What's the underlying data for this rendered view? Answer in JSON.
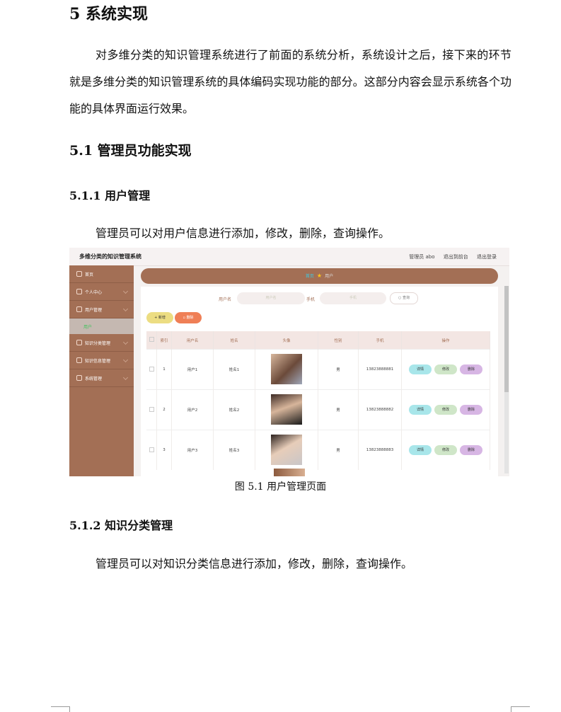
{
  "doc": {
    "h_chapter": "5  系统实现",
    "intro": "对多维分类的知识管理系统进行了前面的系统分析，系统设计之后，接下来的环节就是多维分类的知识管理系统的具体编码实现功能的部分。这部分内容会显示系统各个功能的具体界面运行效果。",
    "h_section": "5.1  管理员功能实现",
    "h_sub1": "5.1.1  用户管理",
    "p_sub1": "管理员可以对用户信息进行添加，修改，删除，查询操作。",
    "caption": "图 5.1  用户管理页面",
    "h_sub2": "5.1.2  知识分类管理",
    "p_sub2": "管理员可以对知识分类信息进行添加，修改，删除，查询操作。"
  },
  "app": {
    "title": "多维分类的知识管理系统",
    "admin_label": "管理员 abo",
    "back_label": "退出到前台",
    "logout_label": "退出登录",
    "menu": {
      "home": "首页",
      "profile": "个人中心",
      "users": "用户管理",
      "users_sub": "用户",
      "categories": "知识分类管理",
      "knowledge": "知识信息管理",
      "system": "系统管理"
    },
    "crumb": {
      "home": "首页",
      "current": "用户"
    },
    "search": {
      "username_label": "用户名",
      "username_placeholder": "用户名",
      "phone_label": "手机",
      "phone_placeholder": "手机",
      "query": "查询"
    },
    "add_label": "新增",
    "delete_label": "删除",
    "columns": [
      "索引",
      "用户名",
      "姓名",
      "头像",
      "性别",
      "手机",
      "操作"
    ],
    "rows": [
      {
        "index": "1",
        "username": "用户1",
        "name": "姓名1",
        "gender": "男",
        "phone": "13823888881"
      },
      {
        "index": "2",
        "username": "用户2",
        "name": "姓名2",
        "gender": "男",
        "phone": "13823888882"
      },
      {
        "index": "3",
        "username": "用户3",
        "name": "姓名3",
        "gender": "男",
        "phone": "13823888883"
      }
    ],
    "ops": {
      "detail": "详情",
      "edit": "修改",
      "remove": "删除"
    }
  }
}
